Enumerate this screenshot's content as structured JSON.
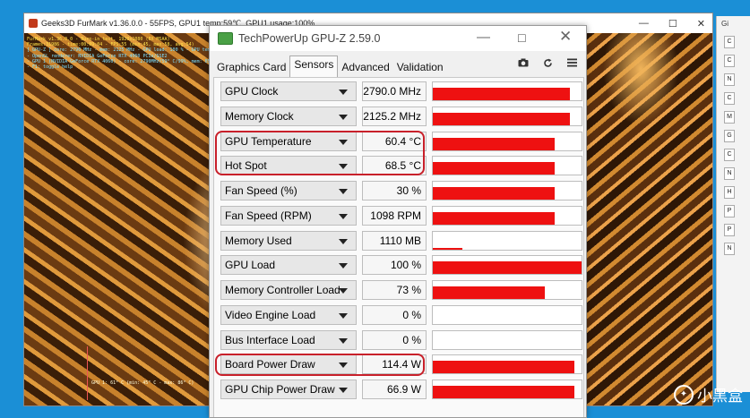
{
  "furmark": {
    "title": "Geeks3D FurMark v1.36.0.0 - 55FPS, GPU1 temp:59℃, GPU1 usage:100%",
    "overlay": [
      {
        "text": "FurMark v1.36.0.0 - Burn-in test, 1920x1080 (8X MSAA)",
        "color": "#ffe24a"
      },
      {
        "text": "Frames:31986 - time:00:09:04 - FPS:55 (min:45, max:58, avg:54)",
        "color": "#ffe24a"
      },
      {
        "text": "[ GPU-Z ] core: 2790 MHz - mem: 2125 MHz - GPU load: 100 % - GPU temp: 60 °C - GPU chip power",
        "color": "#7fe0ff"
      },
      {
        "text": "- OpenGL renderer: NVIDIA GeForce RTX 4060 PCIe/SSE2",
        "color": "#7fe0ff"
      },
      {
        "text": "- GPU 1 (NVIDIA GeForce RTX 4060) - core: 2790MHz/59° C/99%, mem: 8500MHz/13%, fan: 30%, lim",
        "color": "#7fe0ff"
      },
      {
        "text": "- F1: toggle help",
        "color": "#7fe0ff"
      }
    ],
    "graph_label": "GPU 1: 61° C (min: 45° C - max: 86° C)"
  },
  "gpuz": {
    "title": "TechPowerUp GPU-Z 2.59.0",
    "tabs": [
      {
        "label": "Graphics Card",
        "active": false
      },
      {
        "label": "Sensors",
        "active": true
      },
      {
        "label": "Advanced",
        "active": false
      },
      {
        "label": "Validation",
        "active": false
      }
    ],
    "tool_icons": [
      "camera-icon",
      "refresh-icon",
      "menu-icon"
    ],
    "sensors": [
      {
        "name": "GPU Clock",
        "value": "2790.0 MHz",
        "level": 0.92
      },
      {
        "name": "Memory Clock",
        "value": "2125.2 MHz",
        "level": 0.92
      },
      {
        "name": "GPU Temperature",
        "value": "60.4 °C",
        "level": 0.82
      },
      {
        "name": "Hot Spot",
        "value": "68.5 °C",
        "level": 0.82
      },
      {
        "name": "Fan Speed (%)",
        "value": "30 %",
        "level": 0.82
      },
      {
        "name": "Fan Speed (RPM)",
        "value": "1098 RPM",
        "level": 0.82
      },
      {
        "name": "Memory Used",
        "value": "1110 MB",
        "level": 0.2
      },
      {
        "name": "GPU Load",
        "value": "100 %",
        "level": 1.0
      },
      {
        "name": "Memory Controller Load",
        "value": "73 %",
        "level": 0.75
      },
      {
        "name": "Video Engine Load",
        "value": "0 %",
        "level": 0
      },
      {
        "name": "Bus Interface Load",
        "value": "0 %",
        "level": 0
      },
      {
        "name": "Board Power Draw",
        "value": "114.4 W",
        "level": 0.95
      },
      {
        "name": "GPU Chip Power Draw",
        "value": "66.9 W",
        "level": 0.95
      }
    ]
  },
  "side_window": {
    "title": "Gi",
    "items": [
      "C",
      "C",
      "N",
      "C",
      "M",
      "G",
      "C",
      "N",
      "H",
      "P",
      "P",
      "N"
    ]
  },
  "watermark": "小黑盒",
  "colors": {
    "bar": "#ee1111",
    "highlight": "#c8202a",
    "background": "#1b8fd6"
  }
}
